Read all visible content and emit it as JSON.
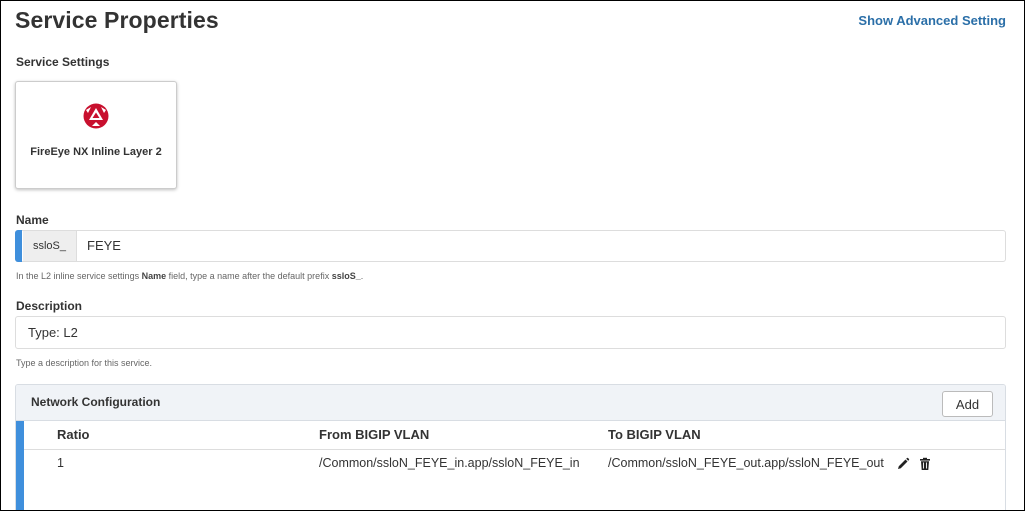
{
  "page": {
    "title": "Service Properties",
    "advanced_link": "Show Advanced Setting"
  },
  "service_settings": {
    "label": "Service Settings",
    "card": {
      "label": "FireEye NX Inline Layer 2",
      "icon": "fireeye-logo-icon"
    }
  },
  "name_field": {
    "label": "Name",
    "prefix": "ssloS_",
    "value": "FEYE",
    "help_before": "In the L2 inline service settings ",
    "help_bold1": "Name",
    "help_middle": " field, type a name after the default prefix ",
    "help_bold2": "ssloS_",
    "help_after": "."
  },
  "description_field": {
    "label": "Description",
    "value": "Type: L2",
    "help": "Type a description for this service."
  },
  "network_config": {
    "title": "Network Configuration",
    "add_label": "Add",
    "columns": [
      "Ratio",
      "From BIGIP VLAN",
      "To BIGIP VLAN"
    ],
    "rows": [
      {
        "ratio": "1",
        "from": "/Common/ssloN_FEYE_in.app/ssloN_FEYE_in",
        "to": "/Common/ssloN_FEYE_out.app/ssloN_FEYE_out"
      }
    ],
    "row_actions": [
      "pencil-icon",
      "trash-icon"
    ]
  },
  "colors": {
    "accent": "#3f8fdc",
    "link": "#2b6fa8",
    "logo": "#c8102e",
    "panel_header": "#f0f3f7"
  }
}
